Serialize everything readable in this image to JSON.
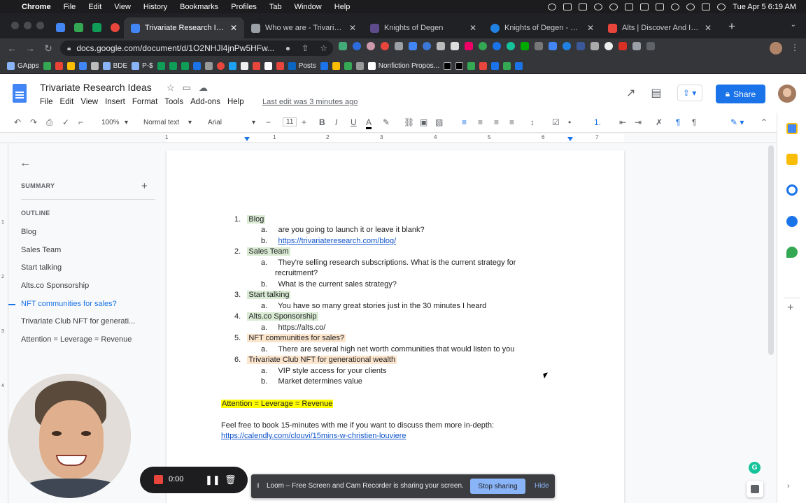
{
  "mac_menu": {
    "apple": "",
    "app": "Chrome",
    "items": [
      "File",
      "Edit",
      "View",
      "History",
      "Bookmarks",
      "Profiles",
      "Tab",
      "Window",
      "Help"
    ],
    "datetime": "Tue Apr 5  6:19 AM"
  },
  "tabs": [
    {
      "title": "Trivariate Research Ideas",
      "active": true,
      "favicon_color": "#4285f4"
    },
    {
      "title": "Who we are - Trivariate Re",
      "active": false,
      "favicon_color": "#9aa0a6"
    },
    {
      "title": "Knights of Degen",
      "active": false,
      "favicon_color": "#5e4b8b"
    },
    {
      "title": "Knights of Degen - Collect",
      "active": false,
      "favicon_color": "#2081e2"
    },
    {
      "title": "Alts | Discover And Invest",
      "active": false,
      "favicon_color": "#e8453c"
    }
  ],
  "omnibox": {
    "url": "docs.google.com/document/d/1O2NHJI4jnPw5HFw..."
  },
  "bookmarks": [
    {
      "label": "GApps",
      "color": "#8ab4f8"
    },
    {
      "label": "",
      "color": "#34a853"
    },
    {
      "label": "",
      "color": "#ea4335"
    },
    {
      "label": "",
      "color": "#fbbc04"
    },
    {
      "label": "",
      "color": "#4285f4"
    },
    {
      "label": "BDE",
      "color": "#8ab4f8"
    },
    {
      "label": "P-$",
      "color": "#8ab4f8"
    },
    {
      "label": "",
      "color": "#0f9d58"
    },
    {
      "label": "",
      "color": "#1a73e8"
    },
    {
      "label": "",
      "color": "#e8453c"
    },
    {
      "label": "Posts",
      "color": "#0a66c2"
    },
    {
      "label": "",
      "color": "#fbbc04"
    },
    {
      "label": "Nonfiction Propos...",
      "color": "#ffffff"
    },
    {
      "label": "",
      "color": "#000000"
    },
    {
      "label": "",
      "color": "#34a853"
    }
  ],
  "docs": {
    "title": "Trivariate Research Ideas",
    "menus": [
      "File",
      "Edit",
      "View",
      "Insert",
      "Format",
      "Tools",
      "Add-ons",
      "Help"
    ],
    "last_edit": "Last edit was 3 minutes ago",
    "share_label": "Share"
  },
  "format_bar": {
    "zoom": "100%",
    "style": "Normal text",
    "font": "Arial",
    "font_size": "11"
  },
  "ruler": {
    "numbers": [
      "1",
      "1",
      "2",
      "3",
      "4",
      "5",
      "6",
      "7"
    ]
  },
  "vruler": {
    "numbers": [
      "1",
      "2",
      "3",
      "4"
    ]
  },
  "sidebar": {
    "summary_label": "SUMMARY",
    "outline_label": "OUTLINE",
    "items": [
      {
        "label": "Blog",
        "active": false
      },
      {
        "label": "Sales Team",
        "active": false
      },
      {
        "label": "Start talking",
        "active": false
      },
      {
        "label": "Alts.co Sponsorship",
        "active": false
      },
      {
        "label": "NFT communities for sales?",
        "active": true
      },
      {
        "label": "Trivariate Club NFT for generati...",
        "active": false
      },
      {
        "label": "Attention = Leverage = Revenue",
        "active": false
      }
    ]
  },
  "document": {
    "lines": [
      {
        "prefix": "1.",
        "text": "Blog",
        "level": 1,
        "hl": "green"
      },
      {
        "prefix": "a.",
        "text": "are you going to launch it or leave it blank?",
        "level": 2
      },
      {
        "prefix": "b.",
        "text": "https://trivariateresearch.com/blog/",
        "level": 2,
        "link": true
      },
      {
        "prefix": "2.",
        "text": "Sales Team",
        "level": 1,
        "hl": "green"
      },
      {
        "prefix": "a.",
        "text": "They're selling research subscriptions. What is the current strategy for",
        "level": 2
      },
      {
        "prefix": "",
        "text": "recruitment?",
        "level": 2
      },
      {
        "prefix": "b.",
        "text": "What is the current sales strategy?",
        "level": 2
      },
      {
        "prefix": "3.",
        "text": "Start talking",
        "level": 1,
        "hl": "green"
      },
      {
        "prefix": "a.",
        "text": "You have so many great stories just in the 30 minutes I heard",
        "level": 2
      },
      {
        "prefix": "4.",
        "text": "Alts.co Sponsorship",
        "level": 1,
        "hl": "green"
      },
      {
        "prefix": "a.",
        "text": "https://alts.co/",
        "level": 2
      },
      {
        "prefix": "5.",
        "text": "NFT communities for sales?",
        "level": 1,
        "hl": "orange"
      },
      {
        "prefix": "a.",
        "text": "There are several high net worth communities that would listen to you",
        "level": 2
      },
      {
        "prefix": "6.",
        "text": "Trivariate Club NFT for generational wealth",
        "level": 1,
        "hl": "orange"
      },
      {
        "prefix": "a.",
        "text": "VIP style access for your clients",
        "level": 2
      },
      {
        "prefix": "b.",
        "text": "Market determines value",
        "level": 2
      }
    ],
    "tagline": "Attention = Leverage = Revenue",
    "closing": "Feel free to book 15-minutes with me if you want to discuss them more in-depth:",
    "calendly": "https://calendly.com/clouvi/15mins-w-christien-louviere"
  },
  "recorder": {
    "time": "0:00"
  },
  "loom": {
    "message": "Loom – Free Screen and Cam Recorder is sharing your screen.",
    "stop_label": "Stop sharing",
    "hide_label": "Hide"
  },
  "colors": {
    "accent": "#1a73e8",
    "highlight_green": "#d9ead3",
    "highlight_orange": "#fce5cd",
    "highlight_yellow": "#ffff00"
  }
}
